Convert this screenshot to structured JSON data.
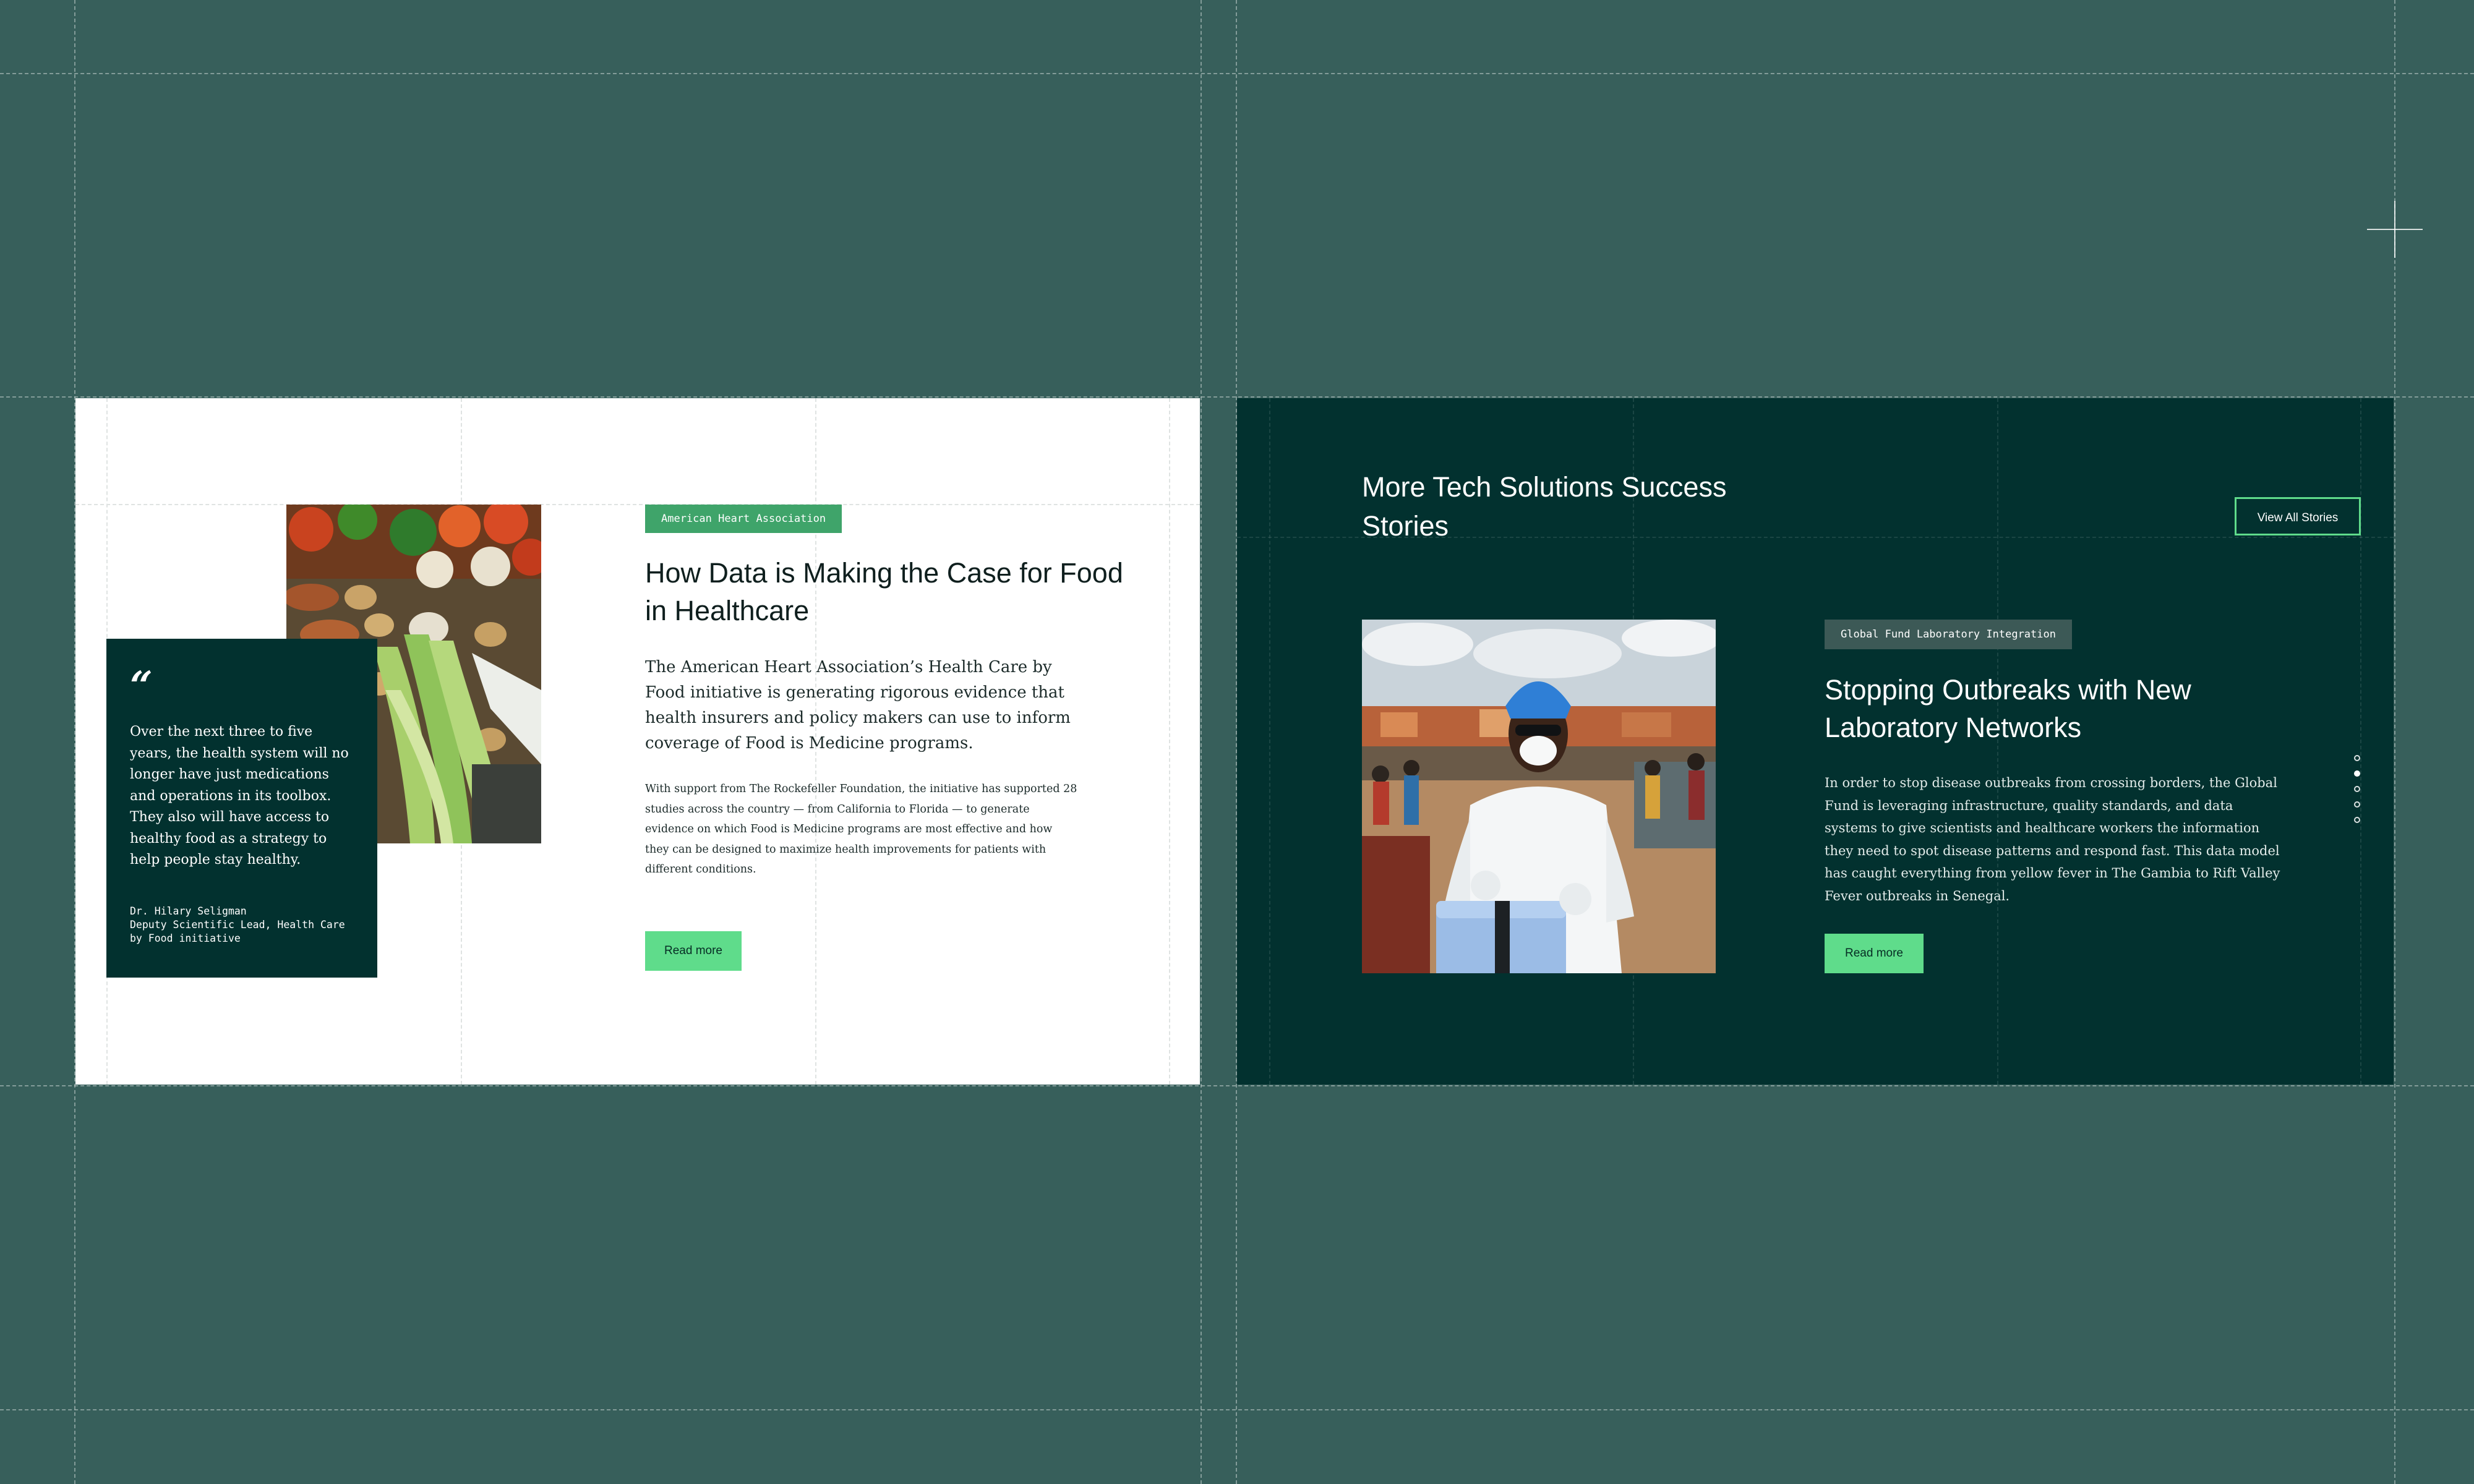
{
  "featured_story": {
    "tag": "American Heart Association",
    "title": "How Data is Making the Case for Food in Healthcare",
    "lead": "The American Heart Association’s Health Care by Food initiative is generating rigorous evidence that health insurers and policy makers can use to inform coverage of Food is Medicine programs.",
    "body": "With support from The Rockefeller Foundation, the initiative has supported 28 studies across the country — from California to Florida — to generate evidence on which Food is Medicine programs are most effective and how they can be designed to maximize health improvements for patients with different conditions.",
    "read_more_label": "Read more",
    "quote": {
      "mark": "“",
      "text": "Over the next three to five years, the health system will no longer have just medications and operations in its toolbox. They also will have access to healthy food as a strategy to help people stay healthy.",
      "author": "Dr. Hilary Seligman",
      "role": "Deputy Scientific Lead, Health Care by Food initiative"
    }
  },
  "more_stories": {
    "heading": "More Tech Solutions Success Stories",
    "view_all_label": "View All Stories",
    "story": {
      "tag": "Global Fund Laboratory Integration",
      "title": "Stopping Outbreaks with New Laboratory Networks",
      "body": "In order to stop disease outbreaks from crossing borders, the Global Fund is leveraging infrastructure, quality standards, and data systems to give scientists and healthcare workers the information they need to spot disease patterns and respond fast. This data model has caught everything from yellow fever in The Gambia to Rift Valley Fever outbreaks in Senegal.",
      "read_more_label": "Read more"
    },
    "carousel": {
      "count": 5,
      "active_index": 1
    }
  },
  "colors": {
    "page_background": "#375f5b",
    "dark_card": "#02312f",
    "accent_green": "#5fdc8b",
    "tag_green": "#3fa46a",
    "tag_slate": "#3c5956"
  }
}
